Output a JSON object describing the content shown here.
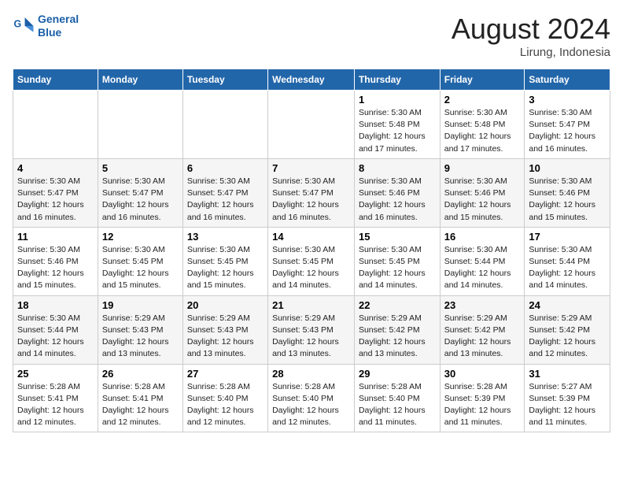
{
  "header": {
    "logo_line1": "General",
    "logo_line2": "Blue",
    "title": "August 2024",
    "subtitle": "Lirung, Indonesia"
  },
  "days_of_week": [
    "Sunday",
    "Monday",
    "Tuesday",
    "Wednesday",
    "Thursday",
    "Friday",
    "Saturday"
  ],
  "weeks": [
    [
      {
        "day": "",
        "info": ""
      },
      {
        "day": "",
        "info": ""
      },
      {
        "day": "",
        "info": ""
      },
      {
        "day": "",
        "info": ""
      },
      {
        "day": "1",
        "info": "Sunrise: 5:30 AM\nSunset: 5:48 PM\nDaylight: 12 hours and 17 minutes."
      },
      {
        "day": "2",
        "info": "Sunrise: 5:30 AM\nSunset: 5:48 PM\nDaylight: 12 hours and 17 minutes."
      },
      {
        "day": "3",
        "info": "Sunrise: 5:30 AM\nSunset: 5:47 PM\nDaylight: 12 hours and 16 minutes."
      }
    ],
    [
      {
        "day": "4",
        "info": "Sunrise: 5:30 AM\nSunset: 5:47 PM\nDaylight: 12 hours and 16 minutes."
      },
      {
        "day": "5",
        "info": "Sunrise: 5:30 AM\nSunset: 5:47 PM\nDaylight: 12 hours and 16 minutes."
      },
      {
        "day": "6",
        "info": "Sunrise: 5:30 AM\nSunset: 5:47 PM\nDaylight: 12 hours and 16 minutes."
      },
      {
        "day": "7",
        "info": "Sunrise: 5:30 AM\nSunset: 5:47 PM\nDaylight: 12 hours and 16 minutes."
      },
      {
        "day": "8",
        "info": "Sunrise: 5:30 AM\nSunset: 5:46 PM\nDaylight: 12 hours and 16 minutes."
      },
      {
        "day": "9",
        "info": "Sunrise: 5:30 AM\nSunset: 5:46 PM\nDaylight: 12 hours and 15 minutes."
      },
      {
        "day": "10",
        "info": "Sunrise: 5:30 AM\nSunset: 5:46 PM\nDaylight: 12 hours and 15 minutes."
      }
    ],
    [
      {
        "day": "11",
        "info": "Sunrise: 5:30 AM\nSunset: 5:46 PM\nDaylight: 12 hours and 15 minutes."
      },
      {
        "day": "12",
        "info": "Sunrise: 5:30 AM\nSunset: 5:45 PM\nDaylight: 12 hours and 15 minutes."
      },
      {
        "day": "13",
        "info": "Sunrise: 5:30 AM\nSunset: 5:45 PM\nDaylight: 12 hours and 15 minutes."
      },
      {
        "day": "14",
        "info": "Sunrise: 5:30 AM\nSunset: 5:45 PM\nDaylight: 12 hours and 14 minutes."
      },
      {
        "day": "15",
        "info": "Sunrise: 5:30 AM\nSunset: 5:45 PM\nDaylight: 12 hours and 14 minutes."
      },
      {
        "day": "16",
        "info": "Sunrise: 5:30 AM\nSunset: 5:44 PM\nDaylight: 12 hours and 14 minutes."
      },
      {
        "day": "17",
        "info": "Sunrise: 5:30 AM\nSunset: 5:44 PM\nDaylight: 12 hours and 14 minutes."
      }
    ],
    [
      {
        "day": "18",
        "info": "Sunrise: 5:30 AM\nSunset: 5:44 PM\nDaylight: 12 hours and 14 minutes."
      },
      {
        "day": "19",
        "info": "Sunrise: 5:29 AM\nSunset: 5:43 PM\nDaylight: 12 hours and 13 minutes."
      },
      {
        "day": "20",
        "info": "Sunrise: 5:29 AM\nSunset: 5:43 PM\nDaylight: 12 hours and 13 minutes."
      },
      {
        "day": "21",
        "info": "Sunrise: 5:29 AM\nSunset: 5:43 PM\nDaylight: 12 hours and 13 minutes."
      },
      {
        "day": "22",
        "info": "Sunrise: 5:29 AM\nSunset: 5:42 PM\nDaylight: 12 hours and 13 minutes."
      },
      {
        "day": "23",
        "info": "Sunrise: 5:29 AM\nSunset: 5:42 PM\nDaylight: 12 hours and 13 minutes."
      },
      {
        "day": "24",
        "info": "Sunrise: 5:29 AM\nSunset: 5:42 PM\nDaylight: 12 hours and 12 minutes."
      }
    ],
    [
      {
        "day": "25",
        "info": "Sunrise: 5:28 AM\nSunset: 5:41 PM\nDaylight: 12 hours and 12 minutes."
      },
      {
        "day": "26",
        "info": "Sunrise: 5:28 AM\nSunset: 5:41 PM\nDaylight: 12 hours and 12 minutes."
      },
      {
        "day": "27",
        "info": "Sunrise: 5:28 AM\nSunset: 5:40 PM\nDaylight: 12 hours and 12 minutes."
      },
      {
        "day": "28",
        "info": "Sunrise: 5:28 AM\nSunset: 5:40 PM\nDaylight: 12 hours and 12 minutes."
      },
      {
        "day": "29",
        "info": "Sunrise: 5:28 AM\nSunset: 5:40 PM\nDaylight: 12 hours and 11 minutes."
      },
      {
        "day": "30",
        "info": "Sunrise: 5:28 AM\nSunset: 5:39 PM\nDaylight: 12 hours and 11 minutes."
      },
      {
        "day": "31",
        "info": "Sunrise: 5:27 AM\nSunset: 5:39 PM\nDaylight: 12 hours and 11 minutes."
      }
    ]
  ]
}
